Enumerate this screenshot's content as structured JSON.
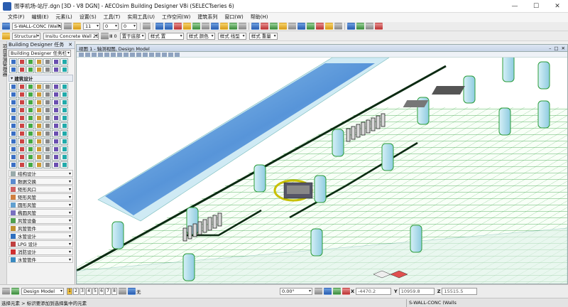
{
  "window": {
    "title": "图李机场-站厅.dgn [3D - V8 DGN] - AECOsim Building Designer V8i (SELECTseries 6)",
    "minimize": "—",
    "maximize": "☐",
    "close": "✕"
  },
  "menu": [
    "文件(F)",
    "编辑(E)",
    "元素(L)",
    "设置(S)",
    "工具(T)",
    "实用工具(U)",
    "工作空间(W)",
    "建筑系列",
    "窗口(W)",
    "帮助(H)"
  ],
  "toolbar1": {
    "level_value": "S-WALL-CONC (Walls: cast",
    "color_value": "11",
    "weight_value": "0",
    "style_value": "0"
  },
  "toolbar2": {
    "family_value": "Structural",
    "part_value": "Insitu Concrete Wall 250mi",
    "transparency_label": "Ⅲ 0",
    "overlay_label": "置于底部",
    "style_combo": "样式 置",
    "style_color": "样式 颜色",
    "style_line": "样式 线型",
    "style_weight": "样式 重量"
  },
  "left_strip": {
    "tab": "项目资源管理器"
  },
  "tasks_panel": {
    "title": "Building Designer 任务",
    "close": "✕",
    "combo": "Building Designer 任务栏",
    "section_title": "建筑设计",
    "categories": [
      {
        "label": "结构设计",
        "icon_color": "#9aa"
      },
      {
        "label": "数据交换",
        "icon_color": "#5a8ad0"
      },
      {
        "label": "矩形风口",
        "icon_color": "#d06060"
      },
      {
        "label": "矩形风管",
        "icon_color": "#d08040"
      },
      {
        "label": "圆形风管",
        "icon_color": "#60a0d0"
      },
      {
        "label": "椭圆风管",
        "icon_color": "#7a70c0"
      },
      {
        "label": "风管设备",
        "icon_color": "#50a050"
      },
      {
        "label": "风管管件",
        "icon_color": "#c09030"
      },
      {
        "label": "水管设计",
        "icon_color": "#3070c0"
      },
      {
        "label": "LPG 设计",
        "icon_color": "#c04040"
      },
      {
        "label": "消防设计",
        "icon_color": "#d03030"
      },
      {
        "label": "水管管件",
        "icon_color": "#3a8ac0"
      }
    ]
  },
  "viewport": {
    "title": "视图 1 - 轴测视图, Design Model",
    "btn_min": "–",
    "btn_max": "□",
    "btn_close": "✕"
  },
  "statusbar": {
    "model_combo": "Design Model",
    "view_numbers": [
      "1",
      "2",
      "3",
      "4",
      "5",
      "6",
      "7",
      "8"
    ],
    "active_view": "1",
    "filter_label": "无",
    "angle_value": "0.00°",
    "x_label": "X",
    "x_value": "-4470.2",
    "y_label": "Y",
    "y_value": "10959.8",
    "z_label": "Z",
    "z_value": "15515.5"
  },
  "prompt": {
    "left": "选择元素 > 标识要添加到选择集中的元素",
    "right": "S-WALL-CONC (Walls"
  },
  "colors": {
    "grid_line": "#2d9d3a",
    "floor": "#f8fff7",
    "glass_panel": "#a7d7e6",
    "water": "#4a8bd6",
    "pipe": "#0b2a12"
  }
}
